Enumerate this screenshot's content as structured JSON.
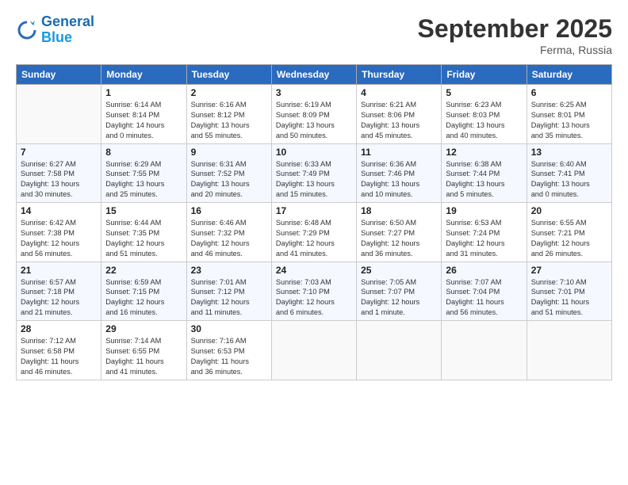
{
  "header": {
    "logo_line1": "General",
    "logo_line2": "Blue",
    "month": "September 2025",
    "location": "Ferma, Russia"
  },
  "days_of_week": [
    "Sunday",
    "Monday",
    "Tuesday",
    "Wednesday",
    "Thursday",
    "Friday",
    "Saturday"
  ],
  "weeks": [
    [
      {
        "day": "",
        "info": ""
      },
      {
        "day": "1",
        "info": "Sunrise: 6:14 AM\nSunset: 8:14 PM\nDaylight: 14 hours\nand 0 minutes."
      },
      {
        "day": "2",
        "info": "Sunrise: 6:16 AM\nSunset: 8:12 PM\nDaylight: 13 hours\nand 55 minutes."
      },
      {
        "day": "3",
        "info": "Sunrise: 6:19 AM\nSunset: 8:09 PM\nDaylight: 13 hours\nand 50 minutes."
      },
      {
        "day": "4",
        "info": "Sunrise: 6:21 AM\nSunset: 8:06 PM\nDaylight: 13 hours\nand 45 minutes."
      },
      {
        "day": "5",
        "info": "Sunrise: 6:23 AM\nSunset: 8:03 PM\nDaylight: 13 hours\nand 40 minutes."
      },
      {
        "day": "6",
        "info": "Sunrise: 6:25 AM\nSunset: 8:01 PM\nDaylight: 13 hours\nand 35 minutes."
      }
    ],
    [
      {
        "day": "7",
        "info": "Sunrise: 6:27 AM\nSunset: 7:58 PM\nDaylight: 13 hours\nand 30 minutes."
      },
      {
        "day": "8",
        "info": "Sunrise: 6:29 AM\nSunset: 7:55 PM\nDaylight: 13 hours\nand 25 minutes."
      },
      {
        "day": "9",
        "info": "Sunrise: 6:31 AM\nSunset: 7:52 PM\nDaylight: 13 hours\nand 20 minutes."
      },
      {
        "day": "10",
        "info": "Sunrise: 6:33 AM\nSunset: 7:49 PM\nDaylight: 13 hours\nand 15 minutes."
      },
      {
        "day": "11",
        "info": "Sunrise: 6:36 AM\nSunset: 7:46 PM\nDaylight: 13 hours\nand 10 minutes."
      },
      {
        "day": "12",
        "info": "Sunrise: 6:38 AM\nSunset: 7:44 PM\nDaylight: 13 hours\nand 5 minutes."
      },
      {
        "day": "13",
        "info": "Sunrise: 6:40 AM\nSunset: 7:41 PM\nDaylight: 13 hours\nand 0 minutes."
      }
    ],
    [
      {
        "day": "14",
        "info": "Sunrise: 6:42 AM\nSunset: 7:38 PM\nDaylight: 12 hours\nand 56 minutes."
      },
      {
        "day": "15",
        "info": "Sunrise: 6:44 AM\nSunset: 7:35 PM\nDaylight: 12 hours\nand 51 minutes."
      },
      {
        "day": "16",
        "info": "Sunrise: 6:46 AM\nSunset: 7:32 PM\nDaylight: 12 hours\nand 46 minutes."
      },
      {
        "day": "17",
        "info": "Sunrise: 6:48 AM\nSunset: 7:29 PM\nDaylight: 12 hours\nand 41 minutes."
      },
      {
        "day": "18",
        "info": "Sunrise: 6:50 AM\nSunset: 7:27 PM\nDaylight: 12 hours\nand 36 minutes."
      },
      {
        "day": "19",
        "info": "Sunrise: 6:53 AM\nSunset: 7:24 PM\nDaylight: 12 hours\nand 31 minutes."
      },
      {
        "day": "20",
        "info": "Sunrise: 6:55 AM\nSunset: 7:21 PM\nDaylight: 12 hours\nand 26 minutes."
      }
    ],
    [
      {
        "day": "21",
        "info": "Sunrise: 6:57 AM\nSunset: 7:18 PM\nDaylight: 12 hours\nand 21 minutes."
      },
      {
        "day": "22",
        "info": "Sunrise: 6:59 AM\nSunset: 7:15 PM\nDaylight: 12 hours\nand 16 minutes."
      },
      {
        "day": "23",
        "info": "Sunrise: 7:01 AM\nSunset: 7:12 PM\nDaylight: 12 hours\nand 11 minutes."
      },
      {
        "day": "24",
        "info": "Sunrise: 7:03 AM\nSunset: 7:10 PM\nDaylight: 12 hours\nand 6 minutes."
      },
      {
        "day": "25",
        "info": "Sunrise: 7:05 AM\nSunset: 7:07 PM\nDaylight: 12 hours\nand 1 minute."
      },
      {
        "day": "26",
        "info": "Sunrise: 7:07 AM\nSunset: 7:04 PM\nDaylight: 11 hours\nand 56 minutes."
      },
      {
        "day": "27",
        "info": "Sunrise: 7:10 AM\nSunset: 7:01 PM\nDaylight: 11 hours\nand 51 minutes."
      }
    ],
    [
      {
        "day": "28",
        "info": "Sunrise: 7:12 AM\nSunset: 6:58 PM\nDaylight: 11 hours\nand 46 minutes."
      },
      {
        "day": "29",
        "info": "Sunrise: 7:14 AM\nSunset: 6:55 PM\nDaylight: 11 hours\nand 41 minutes."
      },
      {
        "day": "30",
        "info": "Sunrise: 7:16 AM\nSunset: 6:53 PM\nDaylight: 11 hours\nand 36 minutes."
      },
      {
        "day": "",
        "info": ""
      },
      {
        "day": "",
        "info": ""
      },
      {
        "day": "",
        "info": ""
      },
      {
        "day": "",
        "info": ""
      }
    ]
  ]
}
